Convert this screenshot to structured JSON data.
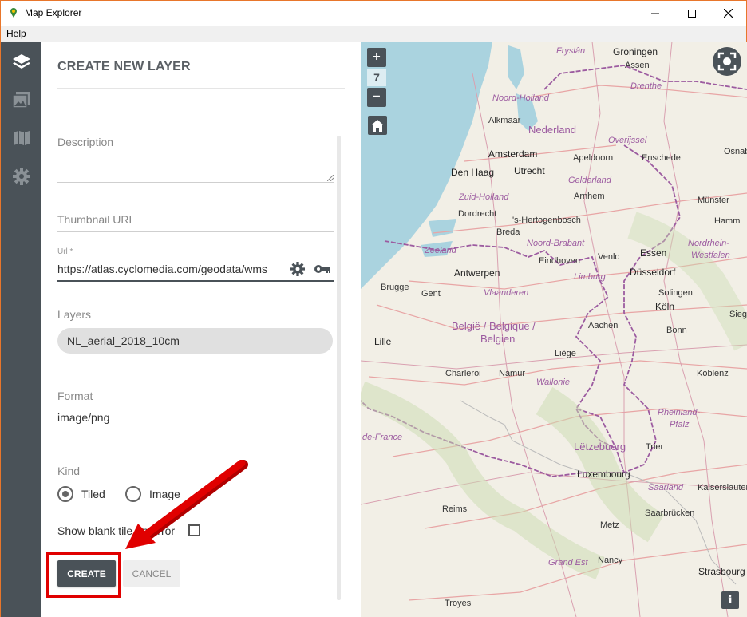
{
  "window": {
    "title": "Map Explorer"
  },
  "menu": {
    "help": "Help"
  },
  "sidebar": {
    "icons": [
      "layers-icon",
      "image-icon",
      "map-icon",
      "gear-icon"
    ]
  },
  "panel": {
    "title": "CREATE NEW LAYER",
    "description_label": "Description",
    "thumbnail_label": "Thumbnail URL",
    "url_label": "Url *",
    "url_value": "https://atlas.cyclomedia.com/geodata/wms",
    "layers_label": "Layers",
    "layers_value": "NL_aerial_2018_10cm",
    "format_label": "Format",
    "format_value": "image/png",
    "kind_label": "Kind",
    "kind_options": [
      {
        "label": "Tiled",
        "checked": true
      },
      {
        "label": "Image",
        "checked": false
      }
    ],
    "blank_tile_label": "Show blank tile on error",
    "create_label": "CREATE",
    "cancel_label": "CANCEL"
  },
  "map": {
    "zoom_in": "+",
    "zoom_level": "7",
    "zoom_out": "−",
    "info": "i",
    "labels": {
      "fryslan": "Fryslân",
      "groningen": "Groningen",
      "assen": "Assen",
      "drenthe": "Drenthe",
      "noord_holland": "Noord-Holland",
      "alkmaar": "Alkmaar",
      "nederland": "Nederland",
      "overijssel": "Overijssel",
      "amsterdam": "Amsterdam",
      "apeldoorn": "Apeldoorn",
      "osnab": "Osnab",
      "den_haag": "Den Haag",
      "utrecht": "Utrecht",
      "enschede": "Enschede",
      "gelderland": "Gelderland",
      "zuid_holland": "Zuid-Holland",
      "arnhem": "Arnhem",
      "dordrecht": "Dordrecht",
      "hertogenbosch": "'s-Hertogenbosch",
      "munster": "Münster",
      "hamm": "Hamm",
      "breda": "Breda",
      "noord_brabant": "Noord-Brabant",
      "zeeland": "Zeeland",
      "nordrhein": "Nordrhein-",
      "westfalen": "Westfalen",
      "venlo": "Venlo",
      "essen": "Essen",
      "eindhoven": "Eindhoven",
      "antwerpen": "Antwerpen",
      "limburg": "Limburg",
      "dusseldorf": "Düsseldorf",
      "brugge": "Brugge",
      "gent": "Gent",
      "vlaanderen": "Vlaanderen",
      "solingen": "Solingen",
      "koln": "Köln",
      "siege": "Siege",
      "belgie": "België / Belgique /",
      "belgien": "Belgien",
      "aachen": "Aachen",
      "bonn": "Bonn",
      "lille": "Lille",
      "liege": "Liège",
      "charleroi": "Charleroi",
      "namur": "Namur",
      "koblenz": "Koblenz",
      "wallonie": "Wallonie",
      "rheinland": "Rheinland-",
      "pfalz": "Pfalz",
      "de_france": "de-France",
      "letzebuerg": "Lëtzebuerg",
      "trier": "Trier",
      "luxembourg": "Luxembourg",
      "saarland": "Saarland",
      "kaiserslautern": "Kaiserslautern",
      "reims": "Reims",
      "saarbrucken": "Saarbrücken",
      "metz": "Metz",
      "grand_est": "Grand Est",
      "nancy": "Nancy",
      "strasbourg": "Strasbourg",
      "troyes": "Troyes"
    }
  },
  "colors": {
    "sidebar_bg": "#4a5258",
    "sea": "#aad3df",
    "land": "#f2efe6",
    "border": "#9c5ba0",
    "highlight": "#e00000"
  }
}
